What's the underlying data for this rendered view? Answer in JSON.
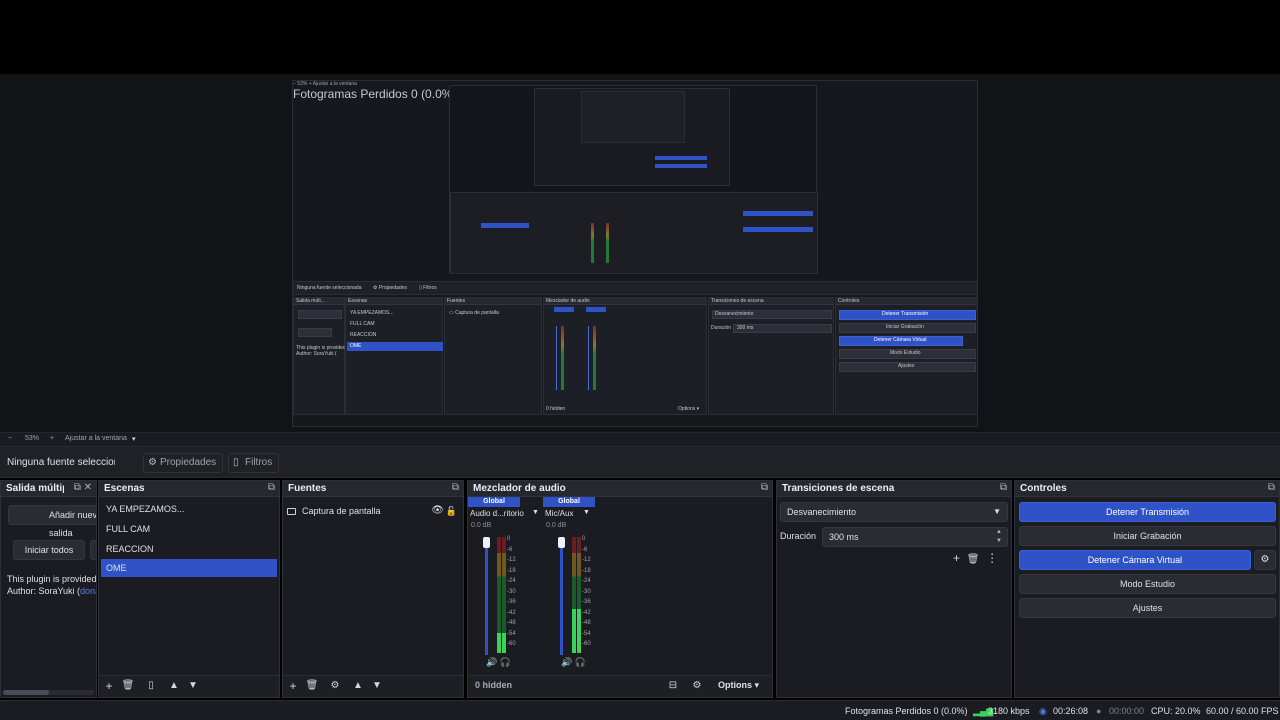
{
  "preview": {
    "zoom": {
      "minus": "−",
      "value": "53%",
      "plus": "+",
      "fit_label": "Ajustar a la ventana",
      "caret": "▾"
    }
  },
  "source_toolbar": {
    "no_source": "Ninguna fuente seleccionada",
    "properties_label": "Propiedades",
    "filters_label": "Filtros"
  },
  "docks": {
    "multi_output": {
      "title": "Salida múltiple",
      "add_button": "Añadir nueva salida",
      "start_all_button": "Iniciar todos",
      "note_line1": "This plugin is provided",
      "note_line2_prefix": "Author: SoraYuki (",
      "note_link": "donate"
    },
    "scenes": {
      "title": "Escenas",
      "items": [
        {
          "label": "YA EMPEZAMOS..."
        },
        {
          "label": "FULL CAM"
        },
        {
          "label": "REACCION"
        },
        {
          "label": "OME"
        }
      ],
      "active_index": 3
    },
    "sources": {
      "title": "Fuentes",
      "items": [
        {
          "label": "Captura de pantalla",
          "visible": true,
          "locked": false
        }
      ]
    },
    "mixer": {
      "title": "Mezclador de audio",
      "channels": [
        {
          "badge": "Global",
          "name": "Audio d...ritorio",
          "db": "0.0 dB",
          "level": 0.17
        },
        {
          "badge": "Global",
          "name": "Mic/Aux",
          "db": "0.0 dB",
          "level": 0.38
        }
      ],
      "scale": [
        "0",
        "-6",
        "-12",
        "-18",
        "-24",
        "-30",
        "-36",
        "-42",
        "-48",
        "-54",
        "-60"
      ],
      "hidden_label": "0 hidden",
      "options_label": "Options"
    },
    "transitions": {
      "title": "Transiciones de escena",
      "selected": "Desvanecimiento",
      "duration_label": "Duración",
      "duration_value": "300 ms"
    },
    "controls": {
      "title": "Controles",
      "stop_stream": "Detener Transmisión",
      "start_record": "Iniciar Grabación",
      "stop_virtualcam": "Detener Cámara Virtual",
      "studio_mode": "Modo Estudio",
      "settings": "Ajustes"
    }
  },
  "status_bar": {
    "dropped_frames": "Fotogramas Perdidos 0 (0.0%)",
    "bitrate": "3180 kbps",
    "stream_time": "00:26:08",
    "record_time": "00:00:00",
    "cpu": "CPU: 20.0%",
    "fps": "60.00 / 60.00 FPS"
  },
  "colors": {
    "accent": "#2f53c7",
    "background": "#1b1c22",
    "panel_header": "#262830"
  }
}
